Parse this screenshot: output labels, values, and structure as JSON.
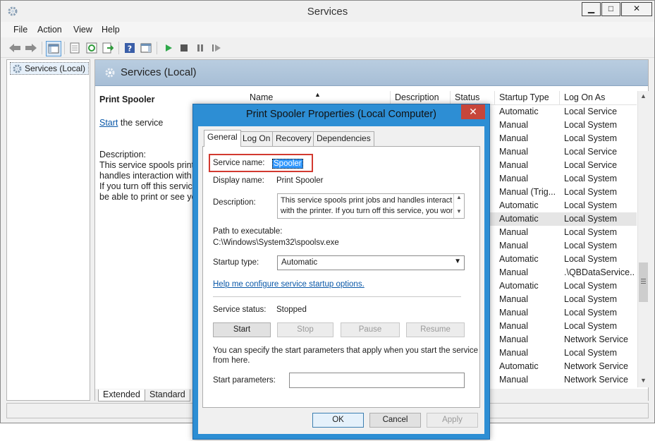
{
  "window": {
    "title": "Services",
    "minimize_glyph": "▁",
    "maximize_glyph": "□",
    "close_glyph": "✕"
  },
  "menu": [
    "File",
    "Action",
    "View",
    "Help"
  ],
  "toolbar_icons": [
    "back-arrow-icon",
    "forward-arrow-icon",
    "show-hide-console-tree-icon",
    "properties-icon",
    "refresh-icon",
    "export-list-icon",
    "help-icon",
    "show-action-pane-icon",
    "play-icon",
    "stop-icon",
    "pause-icon",
    "restart-icon"
  ],
  "tree": {
    "item": "Services (Local)"
  },
  "content": {
    "header_title": "Services (Local)",
    "desc_title": "Print Spooler",
    "start_link": "Start",
    "start_suffix": " the service",
    "desc_label": "Description:",
    "desc_lines": [
      "This service spools print j",
      "handles interaction with t",
      "If you turn off this service",
      "be able to print or see you"
    ]
  },
  "list": {
    "columns": [
      "Name",
      "Description",
      "Status",
      "Startup Type",
      "Log On As"
    ],
    "rows": [
      [
        "Automatic",
        "Local Service"
      ],
      [
        "Manual",
        "Local System"
      ],
      [
        "Manual",
        "Local System"
      ],
      [
        "Manual",
        "Local Service"
      ],
      [
        "Manual",
        "Local Service"
      ],
      [
        "Manual",
        "Local System"
      ],
      [
        "Manual (Trig...",
        "Local System"
      ],
      [
        "Automatic",
        "Local System"
      ],
      [
        "Automatic",
        "Local System"
      ],
      [
        "Manual",
        "Local System"
      ],
      [
        "Manual",
        "Local System"
      ],
      [
        "Automatic",
        "Local System"
      ],
      [
        "Manual",
        ".\\QBDataService..."
      ],
      [
        "Automatic",
        "Local System"
      ],
      [
        "Manual",
        "Local System"
      ],
      [
        "Manual",
        "Local System"
      ],
      [
        "Manual",
        "Local System"
      ],
      [
        "Manual",
        "Network Service"
      ],
      [
        "Manual",
        "Local System"
      ],
      [
        "Automatic",
        "Network Service"
      ],
      [
        "Manual",
        "Network Service"
      ]
    ],
    "selected_row": 8
  },
  "bottom_tabs": [
    "Extended",
    "Standard"
  ],
  "dialog": {
    "title": "Print Spooler Properties (Local Computer)",
    "close_glyph": "✕",
    "tabs": [
      "General",
      "Log On",
      "Recovery",
      "Dependencies"
    ],
    "service_name_label": "Service name:",
    "service_name_value": "Spooler",
    "display_name_label": "Display name:",
    "display_name_value": "Print Spooler",
    "description_label": "Description:",
    "description_lines": [
      "This service spools print jobs and handles interaction",
      "with the printer.  If you turn off this service, you won't"
    ],
    "path_label": "Path to executable:",
    "path_value": "C:\\Windows\\System32\\spoolsv.exe",
    "startup_type_label": "Startup type:",
    "startup_type_value": "Automatic",
    "help_link": "Help me configure service startup options.",
    "status_label": "Service status:",
    "status_value": "Stopped",
    "buttons": {
      "start": "Start",
      "stop": "Stop",
      "pause": "Pause",
      "resume": "Resume"
    },
    "params_hint_lines": [
      "You can specify the start parameters that apply when you start the service",
      "from here."
    ],
    "start_params_label": "Start parameters:",
    "start_params_value": "",
    "footer_buttons": {
      "ok": "OK",
      "cancel": "Cancel",
      "apply": "Apply"
    }
  }
}
